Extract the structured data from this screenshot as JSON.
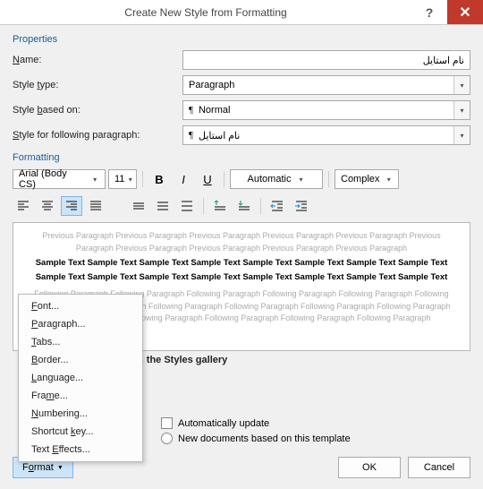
{
  "titlebar": {
    "title": "Create New Style from Formatting"
  },
  "sections": {
    "properties": "Properties",
    "formatting": "Formatting"
  },
  "labels": {
    "name_pre": "",
    "name_ul": "N",
    "name_post": "ame:",
    "type_pre": "Style ",
    "type_ul": "t",
    "type_post": "ype:",
    "based_pre": "Style ",
    "based_ul": "b",
    "based_post": "ased on:",
    "follow_pre": "",
    "follow_ul": "S",
    "follow_post": "tyle for following paragraph:"
  },
  "values": {
    "style_name": "نام استایل",
    "style_type": "Paragraph",
    "based_on": "Normal",
    "following": "نام استایل",
    "font_name": "Arial (Body CS)",
    "font_size": "11",
    "color": "Automatic",
    "script": "Complex"
  },
  "preview": {
    "prev": "Previous Paragraph Previous Paragraph Previous Paragraph Previous Paragraph Previous Paragraph Previous Paragraph Previous Paragraph Previous Paragraph Previous Paragraph Previous Paragraph",
    "sample": "Sample Text Sample Text Sample Text Sample Text Sample Text Sample Text Sample Text Sample Text Sample Text Sample Text Sample Text Sample Text Sample Text Sample Text Sample Text Sample Text",
    "follow": "Following Paragraph Following Paragraph Following Paragraph Following Paragraph Following Paragraph Following Paragraph Following Paragraph Following Paragraph Following Paragraph Following Paragraph Following Paragraph Following Paragraph Following Paragraph Following Paragraph Following Paragraph Following Paragraph"
  },
  "gallery_text": "n the Styles gallery",
  "options": {
    "auto_update": "Automatically update",
    "new_docs": "New documents based on this template"
  },
  "format_menu": {
    "items": [
      {
        "pre": "",
        "ul": "F",
        "post": "ont..."
      },
      {
        "pre": "",
        "ul": "P",
        "post": "aragraph..."
      },
      {
        "pre": "",
        "ul": "T",
        "post": "abs..."
      },
      {
        "pre": "",
        "ul": "B",
        "post": "order..."
      },
      {
        "pre": "",
        "ul": "L",
        "post": "anguage..."
      },
      {
        "pre": "Fra",
        "ul": "m",
        "post": "e..."
      },
      {
        "pre": "",
        "ul": "N",
        "post": "umbering..."
      },
      {
        "pre": "Shortcut ",
        "ul": "k",
        "post": "ey..."
      },
      {
        "pre": "Text ",
        "ul": "E",
        "post": "ffects..."
      }
    ]
  },
  "buttons": {
    "format_pre": "F",
    "format_ul": "o",
    "format_post": "rmat",
    "ok": "OK",
    "cancel": "Cancel"
  }
}
